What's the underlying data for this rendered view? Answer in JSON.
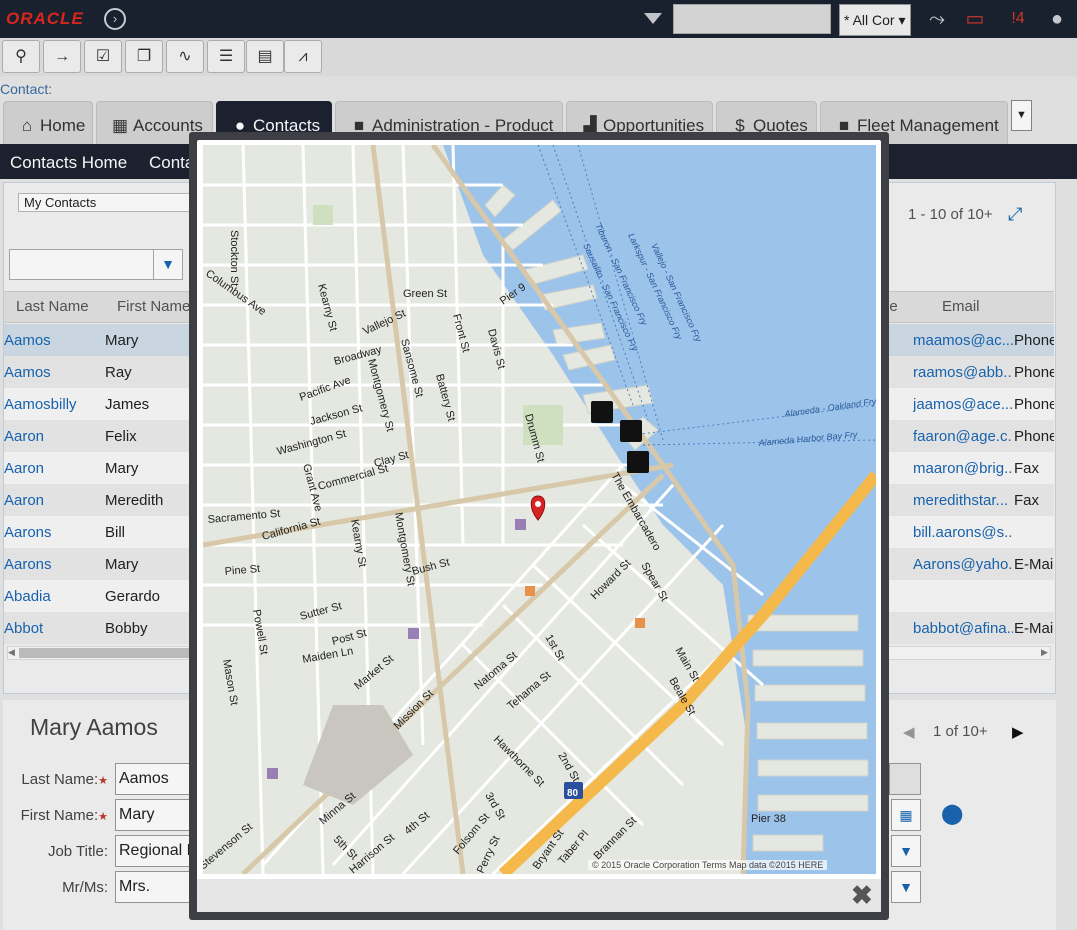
{
  "header": {
    "logo": "ORACLE",
    "search_value": "",
    "scope_select": "* All Cor",
    "notif_count": "4"
  },
  "breadcrumb": "Contact:",
  "tabs": [
    {
      "label": "Home",
      "icon": "home-icon"
    },
    {
      "label": "Accounts",
      "icon": "building-icon"
    },
    {
      "label": "Contacts",
      "icon": "person-icon",
      "active": true
    },
    {
      "label": "Administration - Product",
      "icon": "book-icon"
    },
    {
      "label": "Opportunities",
      "icon": "chart-icon"
    },
    {
      "label": "Quotes",
      "icon": "dollar-icon"
    },
    {
      "label": "Fleet Management",
      "icon": "book-icon"
    }
  ],
  "subnav": [
    "Contacts Home",
    "Conta"
  ],
  "list": {
    "query": "My Contacts",
    "pager": "1 - 10 of 10+",
    "columns": [
      "Last Name",
      "First Name",
      "le",
      "Email"
    ],
    "rows": [
      {
        "last": "Aamos",
        "first": "Mary",
        "email": "maamos@ac...",
        "method": "Phone"
      },
      {
        "last": "Aamos",
        "first": "Ray",
        "email": "raamos@abb...",
        "method": "Phone"
      },
      {
        "last": "Aamosbilly",
        "first": "James",
        "email": "jaamos@ace....",
        "method": "Phone"
      },
      {
        "last": "Aaron",
        "first": "Felix",
        "email": "faaron@age.c...",
        "method": "Phone"
      },
      {
        "last": "Aaron",
        "first": "Mary",
        "email": "maaron@brig...",
        "method": "Fax"
      },
      {
        "last": "Aaron",
        "first": "Meredith",
        "email": "meredithstar...",
        "method": "Fax"
      },
      {
        "last": "Aarons",
        "first": "Bill",
        "email": "bill.aarons@s...",
        "method": ""
      },
      {
        "last": "Aarons",
        "first": "Mary",
        "email": "Aarons@yaho...",
        "method": "E-Mail"
      },
      {
        "last": "Abadia",
        "first": "Gerardo",
        "email": "",
        "method": ""
      },
      {
        "last": "Abbot",
        "first": "Bobby",
        "email": "babbot@afina...",
        "method": "E-Mail"
      }
    ]
  },
  "form": {
    "title": "Mary Aamos",
    "pager": "1 of 10+",
    "fields": [
      {
        "label": "Last Name:",
        "value": "Aamos",
        "required": true
      },
      {
        "label": "First Name:",
        "value": "Mary",
        "required": true
      },
      {
        "label": "Job Title:",
        "value": "Regional M",
        "required": false
      },
      {
        "label": "Mr/Ms:",
        "value": "Mrs.",
        "required": false
      }
    ]
  },
  "map": {
    "credits": "© 2015 Oracle Corporation   Terms   Map data ©2015 HERE",
    "streets": [
      "Stockton St",
      "Columbus Ave",
      "Kearny St",
      "Green St",
      "Vallejo St",
      "Front St",
      "Davis St",
      "Pier 9",
      "Broadway",
      "Sansome St",
      "Pacific Ave",
      "Montgomery St",
      "Battery St",
      "Jackson St",
      "Washington St",
      "Drumm St",
      "Clay St",
      "Commercial St",
      "Sacramento St",
      "California St",
      "Grant Ave",
      "The Embarcadero",
      "Pine St",
      "Bush St",
      "Kearny St",
      "Montgomery St",
      "Sutter St",
      "Howard St",
      "Spear St",
      "Post St",
      "Maiden Ln",
      "Powell St",
      "Mason St",
      "Market St",
      "Natoma St",
      "1st St",
      "Tehama St",
      "Main St",
      "Beale St",
      "Mission St",
      "Hawthorne St",
      "2nd St",
      "Minna St",
      "4th St",
      "Folsom St",
      "3rd St",
      "5th St",
      "Stevenson St",
      "Bryant St",
      "Taber Pl",
      "Brannan St",
      "Pier 38",
      "Harrison St",
      "Perry St"
    ],
    "water_routes": [
      "Tiburon - San Francisco Fry",
      "Sausalito - San Francisco Fry",
      "Larkspur - San Francisco Fry",
      "Vallejo - San Francisco Fry",
      "Alameda - Oakland Fry",
      "Alameda Harbor Bay Fry"
    ],
    "highway": "80"
  },
  "colors": {
    "topbar": "#1b2230",
    "accent": "#1a67b4",
    "water": "#9cc3ea",
    "land": "#e5e8e0",
    "highway": "#f4b94a",
    "pin": "#d62424"
  }
}
